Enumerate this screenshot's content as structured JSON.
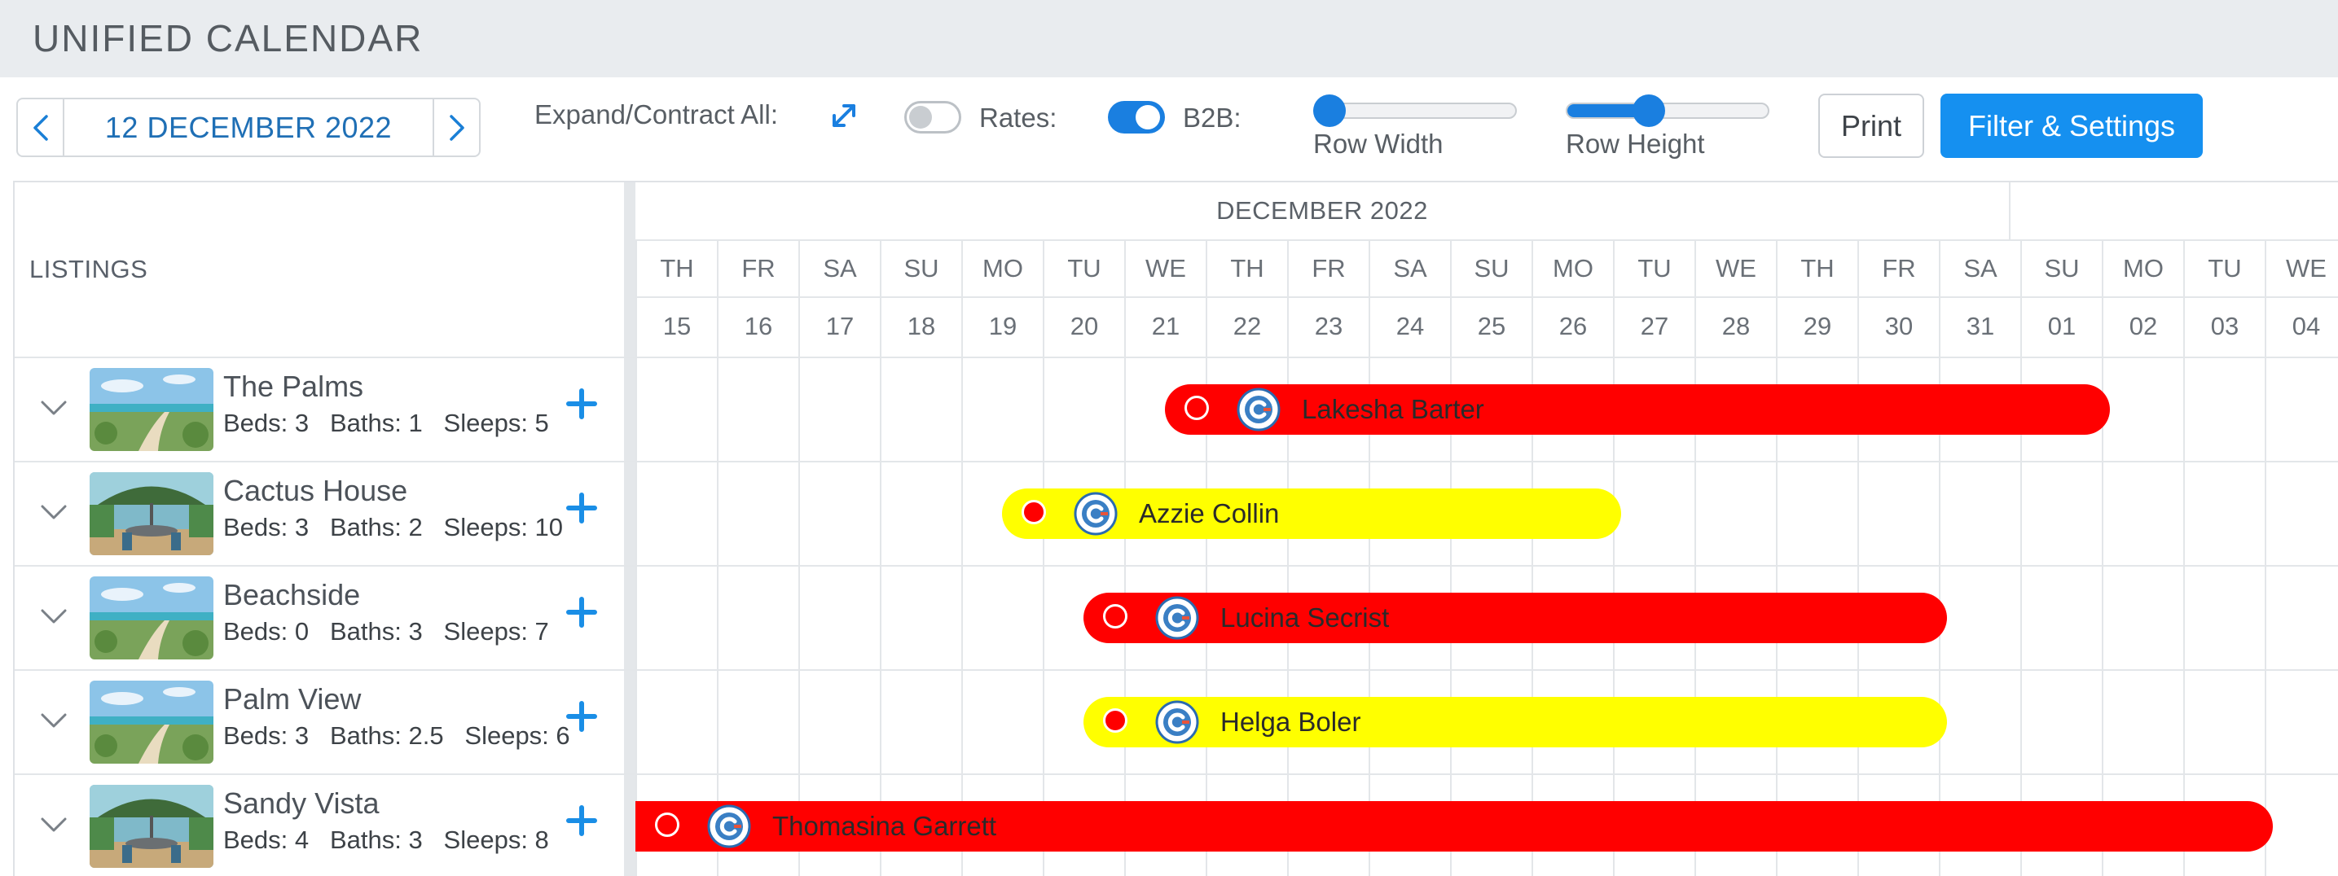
{
  "header": {
    "title": "UNIFIED CALENDAR"
  },
  "toolbar": {
    "date": "12 DECEMBER 2022",
    "expand_label": "Expand/Contract All:",
    "rates_label": "Rates:",
    "rates_on": false,
    "b2b_label": "B2B:",
    "b2b_on": true,
    "row_width_label": "Row Width",
    "row_width_value": 0.0,
    "row_height_label": "Row Height",
    "row_height_value": 0.4,
    "print_label": "Print",
    "filter_label": "Filter & Settings",
    "accent_color": "#1590f0"
  },
  "calendar": {
    "listings_header": "LISTINGS",
    "month_label": "DECEMBER 2022",
    "days": [
      {
        "dow": "TH",
        "num": "15"
      },
      {
        "dow": "FR",
        "num": "16"
      },
      {
        "dow": "SA",
        "num": "17"
      },
      {
        "dow": "SU",
        "num": "18"
      },
      {
        "dow": "MO",
        "num": "19"
      },
      {
        "dow": "TU",
        "num": "20"
      },
      {
        "dow": "WE",
        "num": "21"
      },
      {
        "dow": "TH",
        "num": "22"
      },
      {
        "dow": "FR",
        "num": "23"
      },
      {
        "dow": "SA",
        "num": "24"
      },
      {
        "dow": "SU",
        "num": "25"
      },
      {
        "dow": "MO",
        "num": "26"
      },
      {
        "dow": "TU",
        "num": "27"
      },
      {
        "dow": "WE",
        "num": "28"
      },
      {
        "dow": "TH",
        "num": "29"
      },
      {
        "dow": "FR",
        "num": "30"
      },
      {
        "dow": "SA",
        "num": "31"
      },
      {
        "dow": "SU",
        "num": "01"
      },
      {
        "dow": "MO",
        "num": "02"
      },
      {
        "dow": "TU",
        "num": "03"
      },
      {
        "dow": "WE",
        "num": "04"
      }
    ]
  },
  "listings": [
    {
      "name": "The Palms",
      "specs": "Beds: 3   Baths: 1   Sleeps: 5",
      "photo": "beach",
      "booking": {
        "guest": "Lakesha Barter",
        "color": "red",
        "start_col": 6.5,
        "end_col": 18.1
      }
    },
    {
      "name": "Cactus House",
      "specs": "Beds: 3   Baths: 2   Sleeps: 10",
      "photo": "patio",
      "booking": {
        "guest": "Azzie Collin",
        "color": "yellow",
        "start_col": 4.5,
        "end_col": 12.1
      }
    },
    {
      "name": "Beachside",
      "specs": "Beds: 0   Baths: 3   Sleeps: 7",
      "photo": "beach",
      "booking": {
        "guest": "Lucina Secrist",
        "color": "red",
        "start_col": 5.5,
        "end_col": 16.1
      }
    },
    {
      "name": "Palm View",
      "specs": "Beds: 3   Baths: 2.5   Sleeps: 6",
      "photo": "beach",
      "booking": {
        "guest": "Helga Boler",
        "color": "yellow",
        "start_col": 5.5,
        "end_col": 16.1
      }
    },
    {
      "name": "Sandy Vista",
      "specs": "Beds: 4   Baths: 3   Sleeps: 8",
      "photo": "patio",
      "booking": {
        "guest": "Thomasina Garrett",
        "color": "red",
        "start_col": 0.0,
        "end_col": 20.1
      }
    }
  ]
}
